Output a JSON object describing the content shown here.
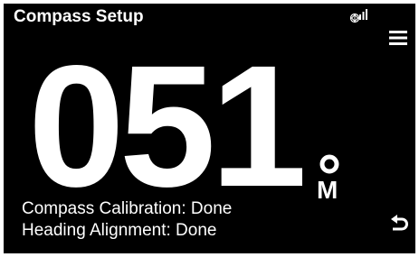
{
  "header": {
    "title": "Compass Setup",
    "signal_icon": "signal-strength-icon",
    "menu_icon": "hamburger-menu-icon"
  },
  "display": {
    "heading": "051",
    "degree_icon": "degree-icon",
    "reference": "M"
  },
  "status": {
    "calibration": "Compass Calibration: Done",
    "alignment": "Heading Alignment: Done"
  },
  "footer": {
    "back_icon": "back-arrow-icon"
  },
  "colors": {
    "background": "#000000",
    "foreground": "#ffffff",
    "border": "#ffffff"
  }
}
